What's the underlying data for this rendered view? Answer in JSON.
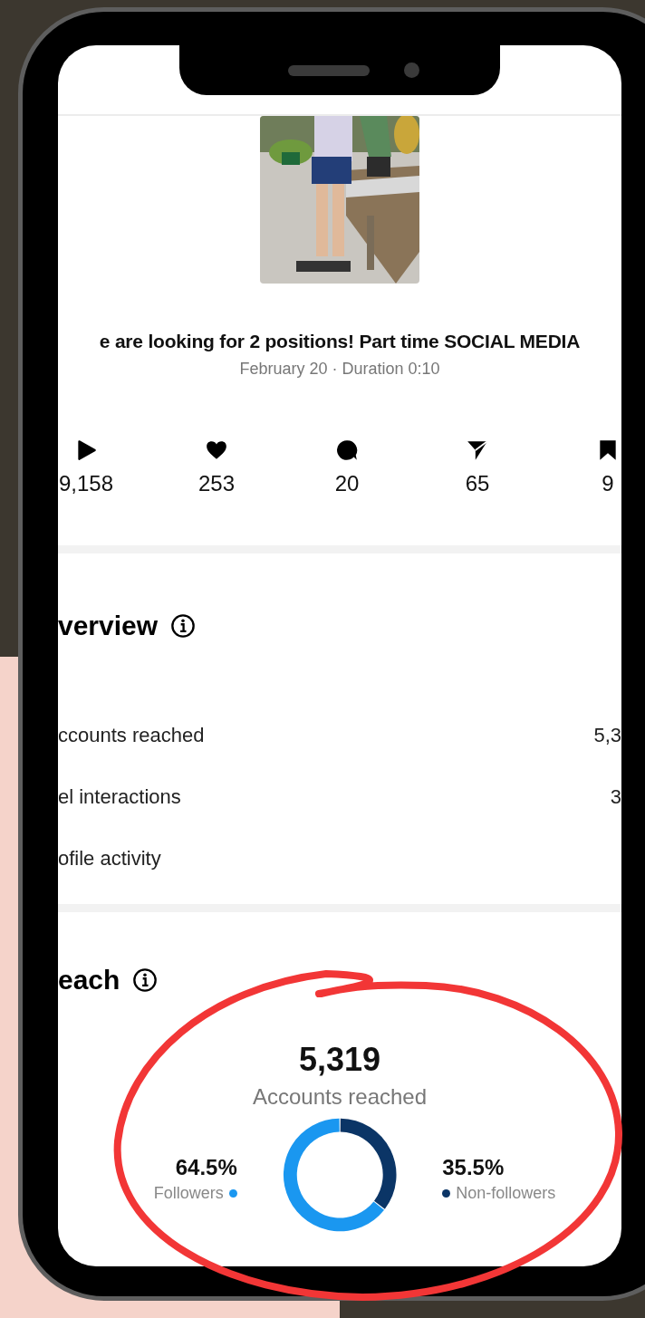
{
  "caption": {
    "text": "e are looking for 2 positions! Part time SOCIAL MEDIA",
    "meta": "February 20 · Duration 0:10"
  },
  "stats": [
    {
      "kind": "plays",
      "value": "9,158"
    },
    {
      "kind": "likes",
      "value": "253"
    },
    {
      "kind": "comments",
      "value": "20"
    },
    {
      "kind": "shares",
      "value": "65"
    },
    {
      "kind": "saves",
      "value": "9"
    }
  ],
  "overview": {
    "title": "verview",
    "rows": [
      {
        "label": "ccounts reached",
        "value": "5,3"
      },
      {
        "label": "el interactions",
        "value": "3"
      },
      {
        "label": "ofile activity"
      }
    ]
  },
  "reach": {
    "title": "each",
    "total": "5,319",
    "total_label": "Accounts reached",
    "legend": [
      {
        "value": "64.5%",
        "label": "Followers",
        "color": "#1a97f0"
      },
      {
        "value": "35.5%",
        "label": "Non-followers",
        "color": "#0b3566"
      }
    ],
    "chart_data": {
      "type": "donut",
      "values": [
        64.5,
        35.5
      ]
    }
  }
}
